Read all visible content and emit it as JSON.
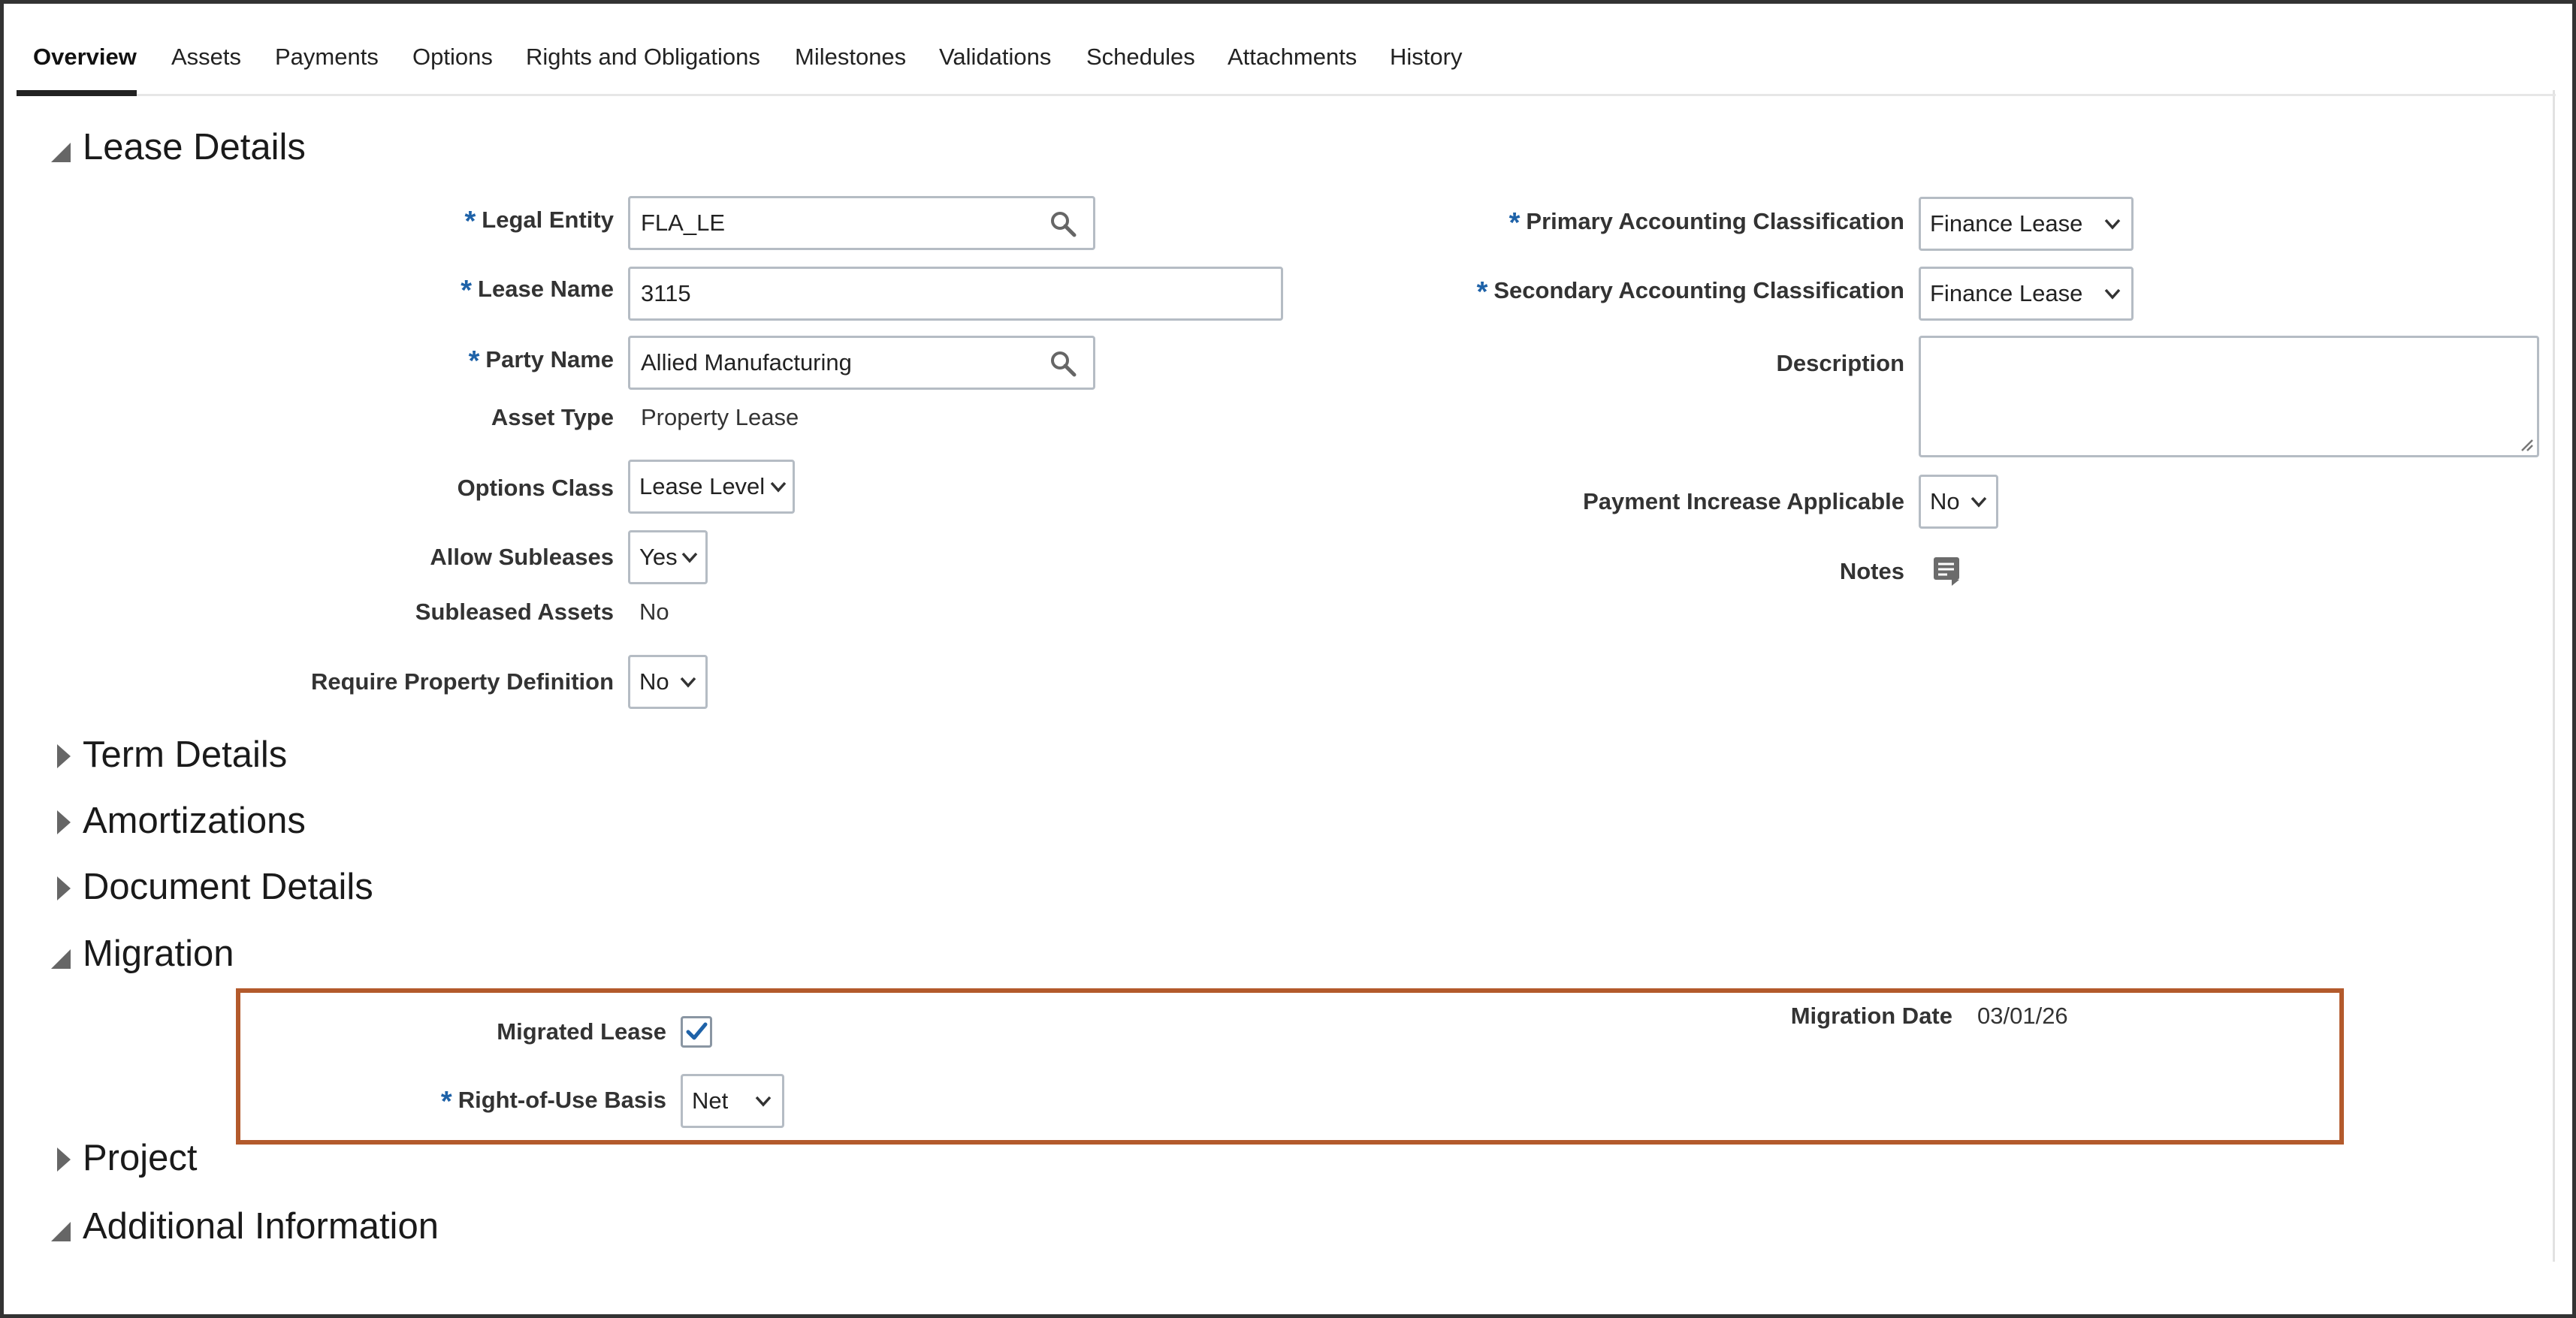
{
  "tabs": [
    "Overview",
    "Assets",
    "Payments",
    "Options",
    "Rights and Obligations",
    "Milestones",
    "Validations",
    "Schedules",
    "Attachments",
    "History"
  ],
  "active_tab": "Overview",
  "sections": {
    "lease_details": "Lease Details",
    "term_details": "Term Details",
    "amortizations": "Amortizations",
    "document_details": "Document Details",
    "migration": "Migration",
    "project": "Project",
    "additional_information": "Additional Information"
  },
  "required_marker": "*",
  "lease": {
    "legal_entity": {
      "label": "Legal Entity",
      "value": "FLA_LE"
    },
    "lease_name": {
      "label": "Lease Name",
      "value": "3115"
    },
    "party_name": {
      "label": "Party Name",
      "value": "Allied Manufacturing"
    },
    "asset_type": {
      "label": "Asset Type",
      "value": "Property Lease"
    },
    "options_class": {
      "label": "Options Class",
      "value": "Lease Level"
    },
    "allow_subleases": {
      "label": "Allow Subleases",
      "value": "Yes"
    },
    "subleased_assets": {
      "label": "Subleased Assets",
      "value": "No"
    },
    "require_property_definition": {
      "label": "Require Property Definition",
      "value": "No"
    },
    "primary_accounting": {
      "label": "Primary Accounting Classification",
      "value": "Finance Lease"
    },
    "secondary_accounting": {
      "label": "Secondary Accounting Classification",
      "value": "Finance Lease"
    },
    "description": {
      "label": "Description",
      "value": ""
    },
    "payment_increase": {
      "label": "Payment Increase Applicable",
      "value": "No"
    },
    "notes": {
      "label": "Notes"
    }
  },
  "migration": {
    "migrated_lease": {
      "label": "Migrated Lease",
      "checked": true
    },
    "rou_basis": {
      "label": "Right-of-Use Basis",
      "value": "Net"
    },
    "migration_date": {
      "label": "Migration Date",
      "value": "03/01/26"
    }
  },
  "icons": {
    "search": "magnifier-icon",
    "dropdown": "chevron-down-icon",
    "notes": "note-icon",
    "expanded": "triangle-down-icon",
    "collapsed": "triangle-right-icon"
  },
  "colors": {
    "required": "#1e62a8",
    "highlight_border": "#b35a2c",
    "checkmark": "#1e62a8"
  }
}
